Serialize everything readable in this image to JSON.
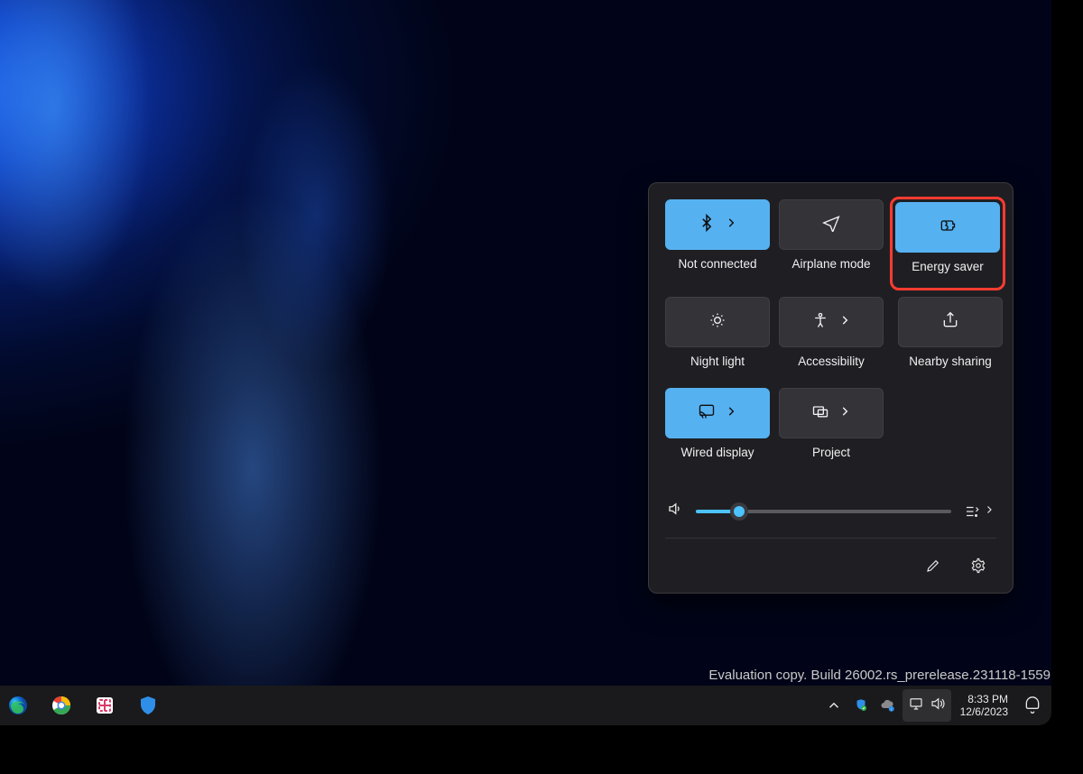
{
  "watermark": "Evaluation copy. Build 26002.rs_prerelease.231118-1559",
  "clock": {
    "time": "8:33 PM",
    "date": "12/6/2023"
  },
  "quick_settings": {
    "tiles": [
      {
        "key": "bluetooth",
        "label": "Not connected",
        "active": true,
        "has_chevron": true
      },
      {
        "key": "airplane",
        "label": "Airplane mode",
        "active": false,
        "has_chevron": false
      },
      {
        "key": "energy",
        "label": "Energy saver",
        "active": true,
        "has_chevron": false,
        "highlighted": true
      },
      {
        "key": "nightlight",
        "label": "Night light",
        "active": false,
        "has_chevron": false
      },
      {
        "key": "accessibility",
        "label": "Accessibility",
        "active": false,
        "has_chevron": true
      },
      {
        "key": "nearby",
        "label": "Nearby sharing",
        "active": false,
        "has_chevron": false
      },
      {
        "key": "cast",
        "label": "Wired display",
        "active": true,
        "has_chevron": true
      },
      {
        "key": "project",
        "label": "Project",
        "active": false,
        "has_chevron": true
      }
    ],
    "volume_percent": 17
  }
}
